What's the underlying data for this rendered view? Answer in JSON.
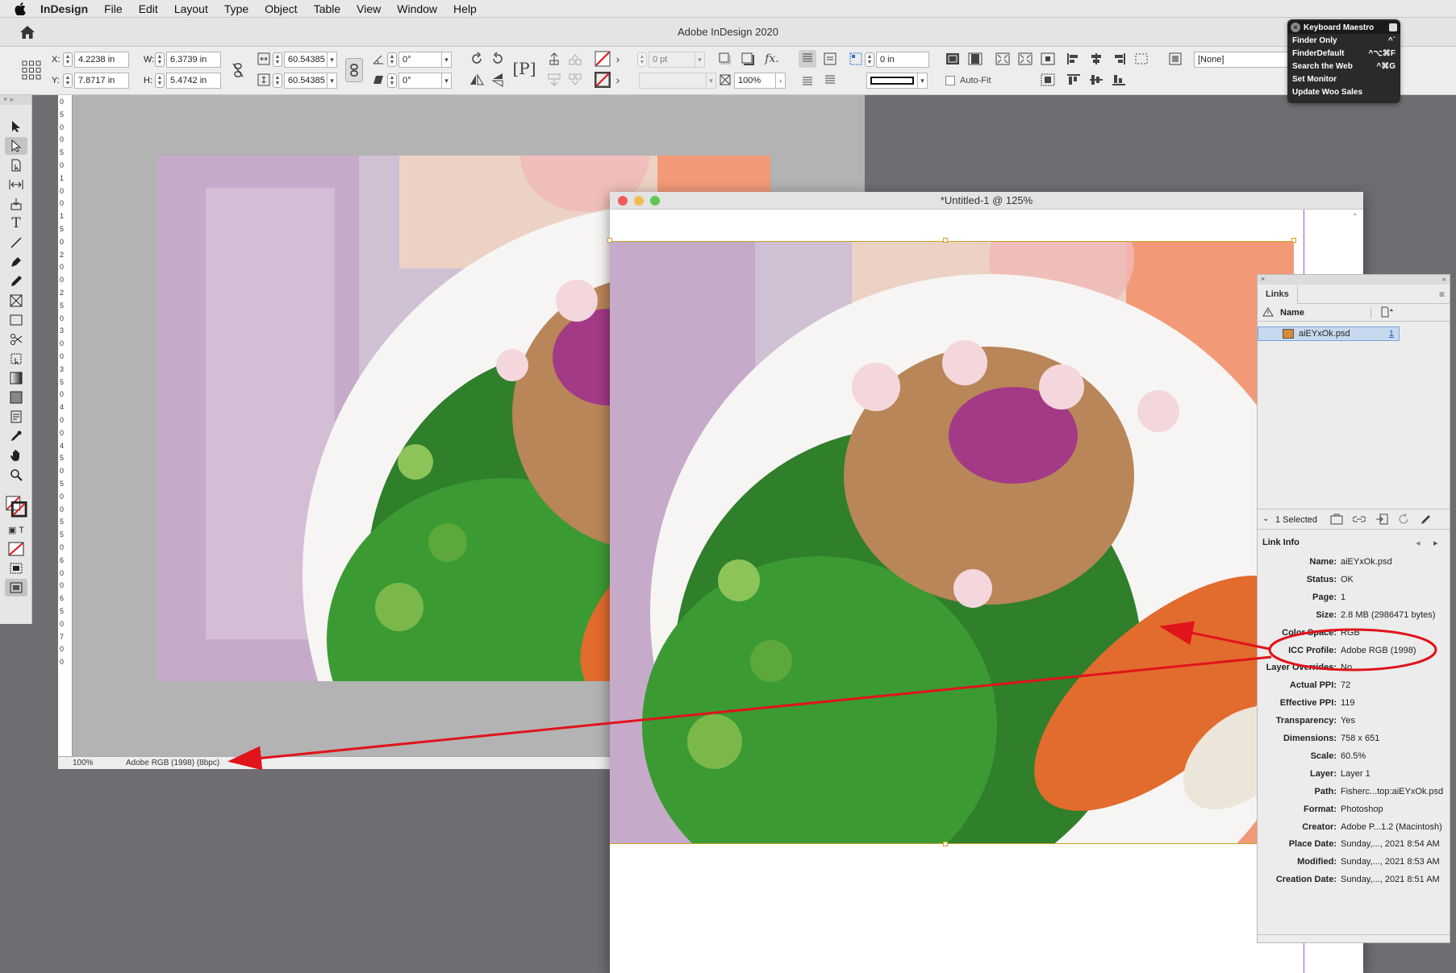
{
  "menubar": {
    "app_name": "InDesign",
    "items": [
      "File",
      "Edit",
      "Layout",
      "Type",
      "Object",
      "Table",
      "View",
      "Window",
      "Help"
    ]
  },
  "app_title": "Adobe InDesign 2020",
  "control": {
    "x_label": "X:",
    "x_value": "4.2238 in",
    "y_label": "Y:",
    "y_value": "7.8717 in",
    "w_label": "W:",
    "w_value": "6.3739 in",
    "h_label": "H:",
    "h_value": "5.4742 in",
    "scale_x": "60.54385",
    "scale_y": "60.54385",
    "rotate": "0°",
    "shear": "0°",
    "stroke_weight": "0 pt",
    "opacity": "100%",
    "offset": "0 in",
    "autofit": "Auto-Fit",
    "style": "[None]"
  },
  "keyboard_maestro": {
    "title": "Keyboard Maestro",
    "items": [
      {
        "label": "Finder Only",
        "shortcut": "^`"
      },
      {
        "label": "FinderDefault",
        "shortcut": "^⌥⌘F"
      },
      {
        "label": "Search the Web",
        "shortcut": "^⌘G"
      },
      {
        "label": "Set Monitor",
        "shortcut": ""
      },
      {
        "label": "Update Woo Sales",
        "shortcut": ""
      }
    ]
  },
  "back_doc": {
    "ruler_ticks": [
      "0",
      "5",
      "0",
      "0",
      "5",
      "0",
      "1",
      "0",
      "0",
      "1",
      "5",
      "0",
      "2",
      "0",
      "0",
      "2",
      "5",
      "0",
      "3",
      "0",
      "0",
      "3",
      "5",
      "0",
      "4",
      "0",
      "0",
      "4",
      "5",
      "0",
      "5",
      "0",
      "0",
      "5",
      "5",
      "0",
      "6",
      "0",
      "0",
      "6",
      "5",
      "0",
      "7",
      "0",
      "0"
    ],
    "zoom": "100%",
    "profile": "Adobe RGB (1998) (8bpc)"
  },
  "front_doc": {
    "title": "*Untitled-1 @ 125%"
  },
  "links": {
    "tab": "Links",
    "col_name": "Name",
    "file": "aiEYxOk.psd",
    "page": "1",
    "selected": "1 Selected",
    "info_title": "Link Info",
    "info": [
      {
        "k": "Name:",
        "v": "aiEYxOk.psd"
      },
      {
        "k": "Status:",
        "v": "OK"
      },
      {
        "k": "Page:",
        "v": "1"
      },
      {
        "k": "Size:",
        "v": "2.8 MB (2986471 bytes)"
      },
      {
        "k": "Color Space:",
        "v": "RGB"
      },
      {
        "k": "ICC Profile:",
        "v": "Adobe RGB (1998)"
      },
      {
        "k": "Layer Overrides:",
        "v": "No"
      },
      {
        "k": "Actual PPI:",
        "v": "72"
      },
      {
        "k": "Effective PPI:",
        "v": "119"
      },
      {
        "k": "Transparency:",
        "v": "Yes"
      },
      {
        "k": "Dimensions:",
        "v": "758 x 651"
      },
      {
        "k": "Scale:",
        "v": "60.5%"
      },
      {
        "k": "Layer:",
        "v": "Layer 1"
      },
      {
        "k": "Path:",
        "v": "Fisherc...top:aiEYxOk.psd"
      },
      {
        "k": "Format:",
        "v": "Photoshop"
      },
      {
        "k": "Creator:",
        "v": "Adobe P...1.2 (Macintosh)"
      },
      {
        "k": "Place Date:",
        "v": "Sunday,..., 2021 8:54 AM"
      },
      {
        "k": "Modified:",
        "v": "Sunday,..., 2021 8:53 AM"
      },
      {
        "k": "Creation Date:",
        "v": "Sunday,..., 2021 8:51 AM"
      }
    ]
  },
  "colors": {
    "annotation": "#e0141a",
    "selection": "#c7d9ef",
    "frame": "#c8a020"
  }
}
